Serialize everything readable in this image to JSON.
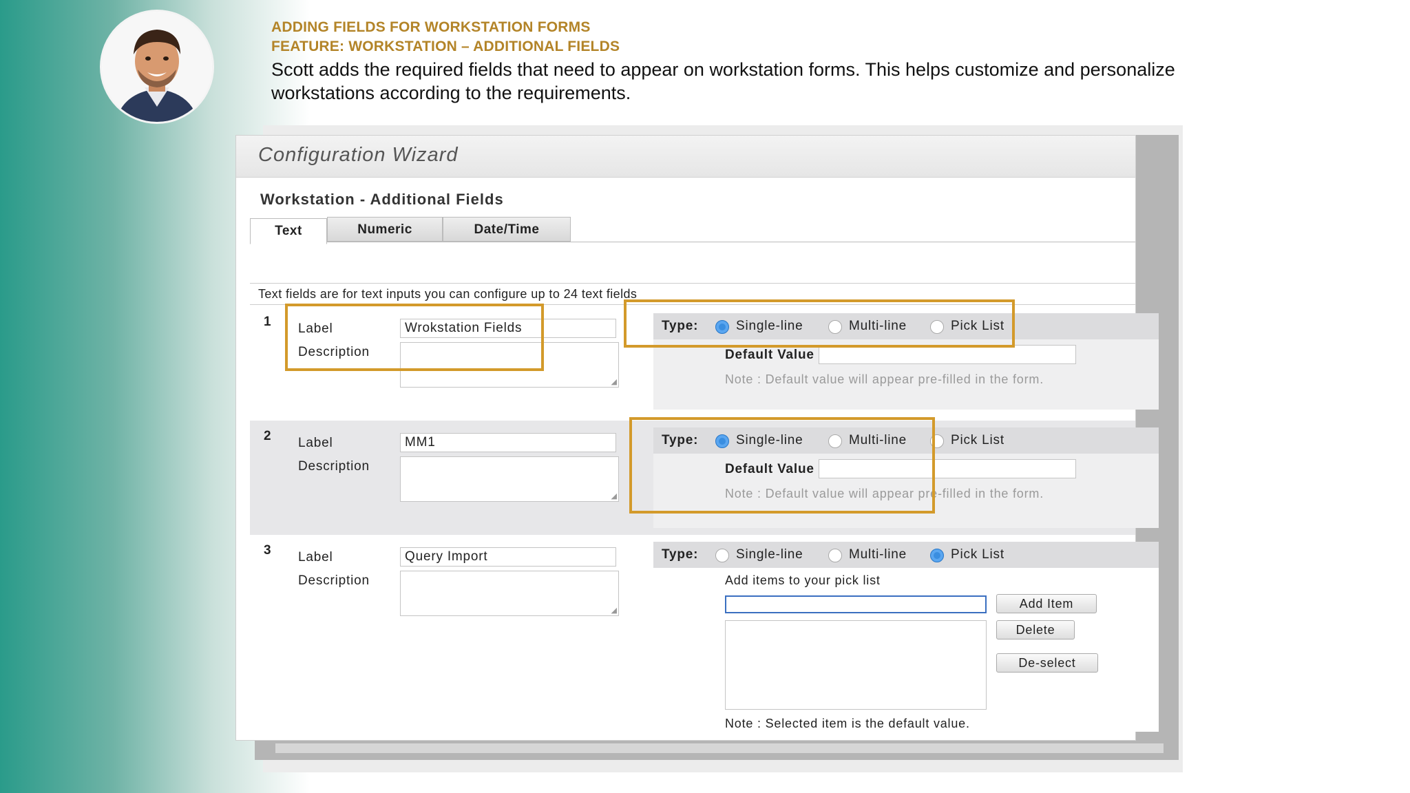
{
  "header": {
    "subtitle1": "ADDING FIELDS FOR WORKSTATION FORMS",
    "subtitle2": "FEATURE: WORKSTATION – ADDITIONAL FIELDS",
    "description": "Scott adds the required fields that need to appear on workstation forms. This helps customize and personalize workstations according to the requirements.",
    "accent_color": "#b38428"
  },
  "wizard": {
    "title": "Configuration Wizard",
    "section_title": "Workstation - Additional Fields",
    "tabs": [
      {
        "label": "Text",
        "active": true
      },
      {
        "label": "Numeric",
        "active": false
      },
      {
        "label": "Date/Time",
        "active": false
      }
    ],
    "info_text": "Text fields are for text inputs you can configure up to 24 text fields",
    "label_caption": "Label",
    "description_caption": "Description",
    "type_caption": "Type:",
    "type_options": [
      "Single-line",
      "Multi-line",
      "Pick List"
    ],
    "default_value_caption": "Default Value",
    "default_note": "Note : Default value will appear pre-filled in the form.",
    "fields": [
      {
        "number": "1",
        "label_value": "Wrokstation Fields",
        "selected_type": "Single-line"
      },
      {
        "number": "2",
        "label_value": "MM1",
        "selected_type": "Single-line"
      },
      {
        "number": "3",
        "label_value": "Query Import",
        "selected_type": "Pick List"
      }
    ],
    "picklist": {
      "caption": "Add items to your pick list",
      "add_button": "Add Item",
      "delete_button": "Delete",
      "deselect_button": "De-select",
      "note": "Note : Selected item is the default value."
    },
    "highlight_color": "#d39a2b"
  }
}
